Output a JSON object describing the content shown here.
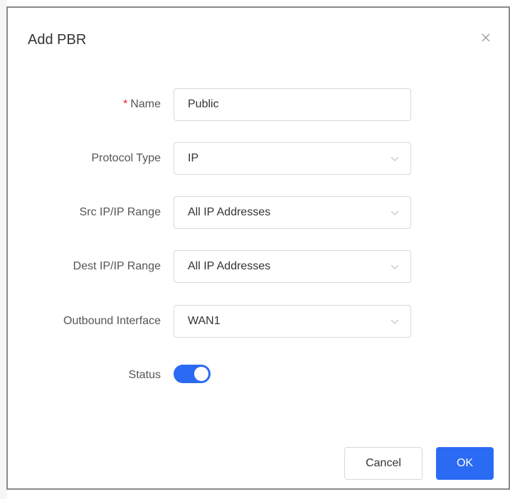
{
  "dialog": {
    "title": "Add PBR",
    "close_icon": "close-icon"
  },
  "form": {
    "name": {
      "label": "Name",
      "required_mark": "*",
      "value": "Public"
    },
    "protocol_type": {
      "label": "Protocol Type",
      "value": "IP"
    },
    "src_ip": {
      "label": "Src IP/IP Range",
      "value": "All IP Addresses"
    },
    "dest_ip": {
      "label": "Dest IP/IP Range",
      "value": "All IP Addresses"
    },
    "outbound_interface": {
      "label": "Outbound Interface",
      "value": "WAN1"
    },
    "status": {
      "label": "Status",
      "enabled": true
    }
  },
  "buttons": {
    "cancel_label": "Cancel",
    "ok_label": "OK"
  },
  "colors": {
    "accent": "#2b6bf3",
    "required": "#f5222d",
    "border": "#d9d9d9"
  }
}
